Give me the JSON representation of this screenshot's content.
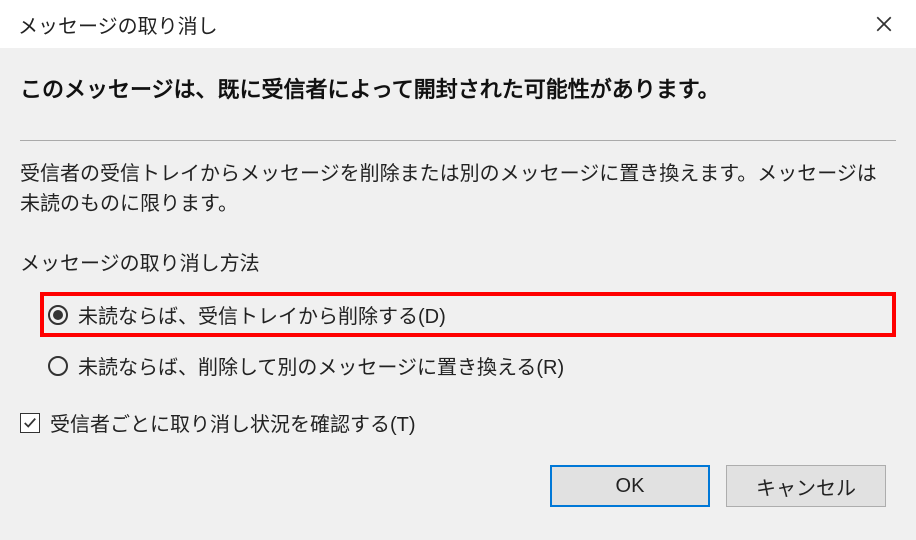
{
  "titlebar": {
    "title": "メッセージの取り消し"
  },
  "heading": "このメッセージは、既に受信者によって開封された可能性があります。",
  "description": "受信者の受信トレイからメッセージを削除または別のメッセージに置き換えます。メッセージは未読のものに限ります。",
  "section_label": "メッセージの取り消し方法",
  "radio": {
    "option_delete": "未読ならば、受信トレイから削除する(D)",
    "option_replace": "未読ならば、削除して別のメッセージに置き換える(R)",
    "selected": "delete"
  },
  "checkbox": {
    "confirm_label": "受信者ごとに取り消し状況を確認する(T)",
    "checked": true
  },
  "buttons": {
    "ok": "OK",
    "cancel": "キャンセル"
  }
}
